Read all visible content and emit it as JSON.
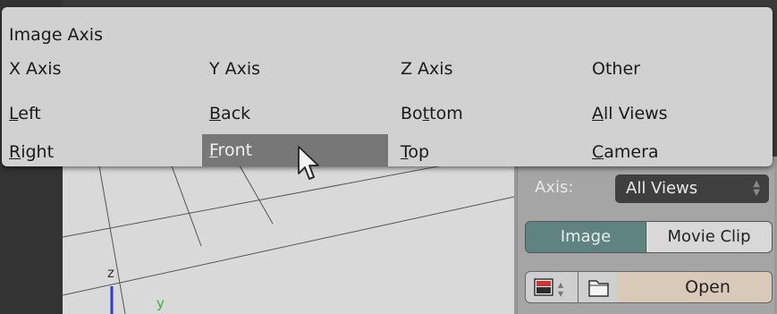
{
  "menu": {
    "title": "Image Axis",
    "columns": [
      {
        "header": "X Axis",
        "items": [
          {
            "pre": "",
            "mn": "L",
            "post": "eft"
          },
          {
            "pre": "",
            "mn": "R",
            "post": "ight"
          }
        ]
      },
      {
        "header": "Y Axis",
        "items": [
          {
            "pre": "",
            "mn": "B",
            "post": "ack"
          },
          {
            "pre": "",
            "mn": "F",
            "post": "ront"
          }
        ]
      },
      {
        "header": "Z Axis",
        "items": [
          {
            "pre": "Bo",
            "mn": "t",
            "post": "tom"
          },
          {
            "pre": "",
            "mn": "T",
            "post": "op"
          }
        ]
      },
      {
        "header": "Other",
        "items": [
          {
            "pre": "",
            "mn": "A",
            "post": "ll Views"
          },
          {
            "pre": "",
            "mn": "C",
            "post": "amera"
          }
        ]
      }
    ],
    "highlighted_item": "Front"
  },
  "panel": {
    "axis_label": "Axis:",
    "axis_value": "All Views",
    "source_tabs": [
      "Image",
      "Movie Clip"
    ],
    "active_tab": "Image",
    "open_label": "Open"
  },
  "viewport": {
    "axis_z_label": "z",
    "axis_y_label": "y"
  },
  "colors": {
    "menu_bg": "#d1d1d1",
    "highlight": "#777777",
    "active_tab": "#5f8480",
    "open_button": "#d8c9b8"
  }
}
